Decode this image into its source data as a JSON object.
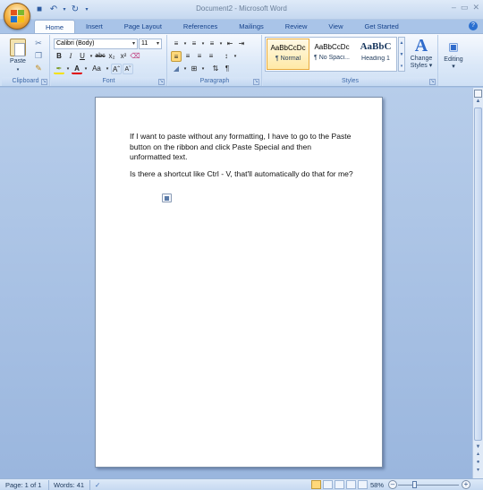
{
  "window": {
    "title": "Document2 - Microsoft Word"
  },
  "qat": {
    "save_icon": "save-icon",
    "undo_icon": "undo-icon",
    "redo_icon": "redo-icon"
  },
  "tabs": [
    {
      "label": "Home",
      "active": true
    },
    {
      "label": "Insert"
    },
    {
      "label": "Page Layout"
    },
    {
      "label": "References"
    },
    {
      "label": "Mailings"
    },
    {
      "label": "Review"
    },
    {
      "label": "View"
    },
    {
      "label": "Get Started"
    }
  ],
  "ribbon": {
    "clipboard": {
      "label": "Clipboard",
      "paste_label": "Paste"
    },
    "font": {
      "label": "Font",
      "family": "Calibri (Body)",
      "size": "11"
    },
    "paragraph": {
      "label": "Paragraph"
    },
    "styles": {
      "label": "Styles",
      "tiles": [
        {
          "sample": "AaBbCcDc",
          "name": "¶ Normal"
        },
        {
          "sample": "AaBbCcDc",
          "name": "¶ No Spaci..."
        },
        {
          "sample": "AaBbC",
          "name": "Heading 1"
        }
      ],
      "change_styles_label1": "Change",
      "change_styles_label2": "Styles"
    },
    "editing": {
      "label": "Editing"
    }
  },
  "document": {
    "paragraph1": "If I want to paste without any formatting, I have to go to the Paste button on the ribbon and click Paste Special and then unformatted text.",
    "paragraph2": "Is there a shortcut like Ctrl - V, that'll automatically  do that for me?"
  },
  "status": {
    "page": "Page: 1 of 1",
    "words": "Words: 41",
    "zoom": "58%"
  },
  "colors": {
    "accent": "#15428b",
    "ribbon": "#dbe8f8",
    "doc_bg": "#a9c4e8"
  }
}
